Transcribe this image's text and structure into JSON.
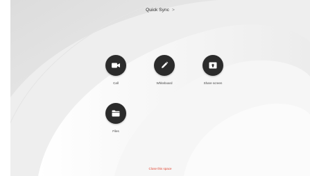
{
  "header": {
    "title": "Quick Sync",
    "chevron": ">"
  },
  "actions": [
    {
      "label": "Call",
      "icon": "video-camera-icon"
    },
    {
      "label": "Whiteboard",
      "icon": "pencil-icon"
    },
    {
      "label": "Share screen",
      "icon": "share-screen-icon"
    },
    {
      "label": "Files",
      "icon": "folder-icon"
    }
  ],
  "footer": {
    "close_label": "Close this space"
  },
  "colors": {
    "button_bg": "#2b2b2b",
    "close_link": "#e0422f",
    "background": "#f2f2f2"
  }
}
